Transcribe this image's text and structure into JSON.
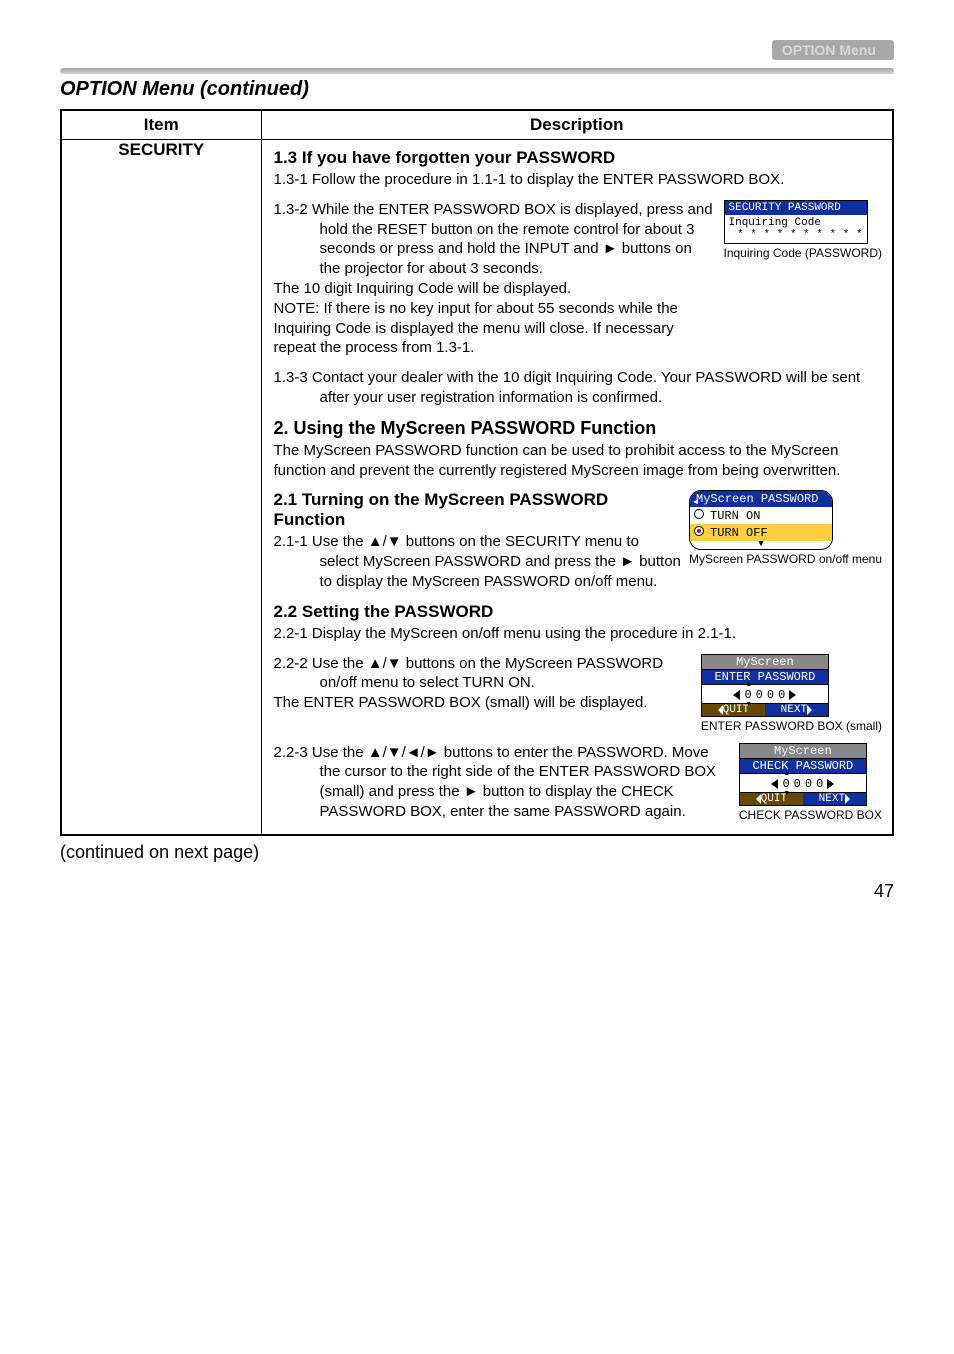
{
  "header": {
    "menu_label": "OPTION Menu"
  },
  "section_title": "OPTION Menu (continued)",
  "table": {
    "header_item": "Item",
    "header_desc": "Description",
    "item_label": "SECURITY"
  },
  "s13": {
    "title": "1.3 If you have forgotten your PASSWORD",
    "p1": "1.3-1 Follow the procedure in 1.1-1 to display the ENTER PASSWORD BOX.",
    "p2a": "1.3-2 While the ENTER PASSWORD BOX is displayed, press and hold the RESET button on the remote control for about 3 seconds or press and hold the INPUT and ► buttons on the projector for about 3 seconds.",
    "p2b": "The 10 digit Inquiring Code will be displayed.",
    "p2c": "NOTE: If there is no key input for about 55 seconds while the Inquiring Code is displayed the menu will close. If necessary repeat the process from 1.3-1.",
    "p3": "1.3-3 Contact your dealer with the 10 digit Inquiring Code. Your PASSWORD will be sent after your user registration information is confirmed."
  },
  "s2": {
    "title": "2. Using the MyScreen PASSWORD Function",
    "intro": "The MyScreen PASSWORD function can be used to prohibit access to the MyScreen function and prevent the currently registered MyScreen image from being overwritten."
  },
  "s21": {
    "title": "2.1 Turning on the MyScreen PASSWORD Function",
    "p1": "2.1-1 Use the ▲/▼ buttons on the SECURITY menu to select MyScreen PASSWORD and press the ► button to display the MyScreen PASSWORD on/off menu."
  },
  "s22": {
    "title": "2.2 Setting the PASSWORD",
    "p1": "2.2-1 Display the MyScreen on/off menu using the procedure in 2.1-1.",
    "p2a": "2.2-2 Use the ▲/▼ buttons on the MyScreen PASSWORD on/off menu to select TURN ON.",
    "p2b": "The ENTER PASSWORD BOX (small) will be displayed.",
    "p3": "2.2-3 Use the ▲/▼/◄/► buttons to enter the PASSWORD. Move the cursor to the right side of the ENTER PASSWORD BOX (small) and press the ► button to display the CHECK PASSWORD BOX, enter the same PASSWORD again."
  },
  "panels": {
    "inq_header": "SECURITY PASSWORD",
    "inq_label": "Inquiring Code",
    "inq_stars": "* *  * * * *  * * * *",
    "inq_caption": "Inquiring Code (PASSWORD)",
    "ms_title": "MyScreen PASSWORD",
    "ms_on": "TURN ON",
    "ms_off": "TURN OFF",
    "ms_caption": "MyScreen PASSWORD on/off menu",
    "enter_t1": "MyScreen",
    "enter_t2": "ENTER PASSWORD",
    "enter_caption": "ENTER PASSWORD BOX (small)",
    "check_t1": "MyScreen",
    "check_t2": "CHECK PASSWORD",
    "check_caption": "CHECK PASSWORD BOX",
    "quit": "QUIT",
    "next": "NEXT"
  },
  "footer": "(continued on next page)",
  "page_number": "47"
}
